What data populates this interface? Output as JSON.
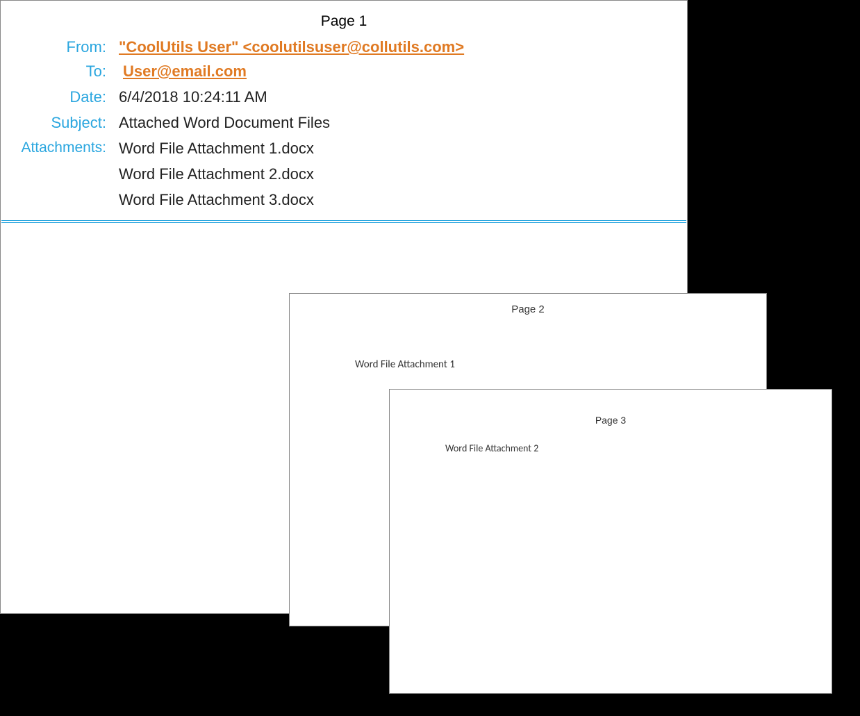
{
  "page1": {
    "label": "Page 1",
    "from_label": "From:",
    "from_value": "\"CoolUtils User\" <coolutilsuser@collutils.com>",
    "to_label": "To:",
    "to_value": "User@email.com",
    "date_label": "Date:",
    "date_value": "6/4/2018 10:24:11 AM",
    "subject_label": "Subject:",
    "subject_value": "Attached Word Document Files",
    "attachments_label": "Attachments:",
    "attachments": [
      "Word File Attachment 1.docx",
      "Word File Attachment 2.docx",
      "Word File Attachment 3.docx"
    ]
  },
  "page2": {
    "label": "Page 2",
    "content": "Word File Attachment 1"
  },
  "page3": {
    "label": "Page 3",
    "content": "Word File Attachment 2"
  }
}
